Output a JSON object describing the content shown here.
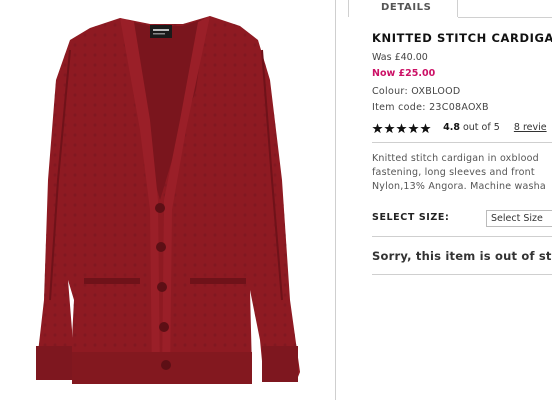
{
  "product_image": {
    "garment_color": "#8e1a22",
    "garment_shadow": "#6f1219",
    "label_color": "#1a1a1a",
    "label_text": "TOPSHOP",
    "buttons_count": 5
  },
  "tabs": [
    {
      "label": "DETAILS"
    }
  ],
  "product": {
    "title": "KNITTED STITCH CARDIGAN",
    "was_price": "Was £40.00",
    "now_price": "Now £25.00",
    "sale_color": "#cc1166",
    "colour": "Colour: OXBLOOD",
    "item_code": "Item code: 23C08AOXB",
    "rating": {
      "stars": 5,
      "score_text": "4.8",
      "out_of_text": "out of 5",
      "reviews_text": "8 revie"
    },
    "description": [
      "Knitted stitch cardigan in oxblood",
      "fastening, long sleeves and front",
      "Nylon,13% Angora. Machine washa"
    ],
    "size": {
      "label": "SELECT SIZE:",
      "selected": "Select Size"
    },
    "out_of_stock": "Sorry, this item is out of stoc"
  }
}
